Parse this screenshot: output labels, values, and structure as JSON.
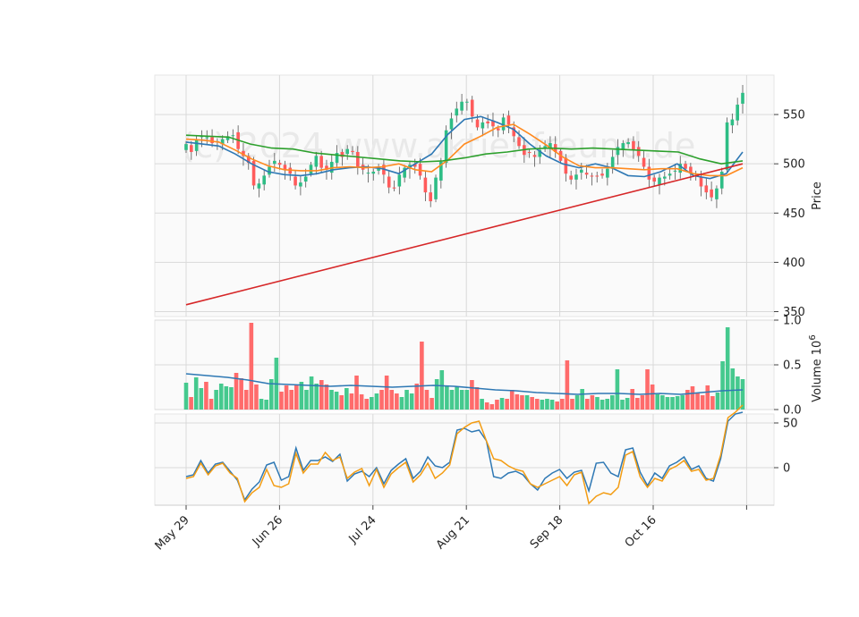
{
  "chart_data": {
    "type": "candlestick",
    "watermark": "(c) 2024 www.aktienfreund.de",
    "x_tick_labels": [
      "May 29",
      "Jun 26",
      "Jul 24",
      "Aug 21",
      "Sep 18",
      "Oct 16",
      ""
    ],
    "panels": [
      {
        "name": "price",
        "ylabel": "Price",
        "ylim": [
          345,
          590
        ],
        "yticks": [
          350,
          400,
          450,
          500,
          550
        ],
        "grid": true,
        "candles_close_path": [
          520,
          512,
          524,
          528,
          527,
          521,
          523,
          525,
          528,
          529,
          515,
          508,
          501,
          478,
          480,
          488,
          497,
          503,
          499,
          494,
          490,
          478,
          481,
          487,
          499,
          508,
          496,
          494,
          502,
          511,
          507,
          515,
          512,
          497,
          494,
          491,
          492,
          496,
          489,
          476,
          475,
          489,
          496,
          499,
          497,
          488,
          471,
          462,
          486,
          502,
          534,
          546,
          556,
          563,
          563,
          548,
          537,
          542,
          541,
          538,
          534,
          547,
          540,
          528,
          518,
          509,
          511,
          507,
          514,
          518,
          521,
          512,
          503,
          490,
          484,
          489,
          494,
          489,
          487,
          487,
          488,
          495,
          507,
          517,
          521,
          522,
          514,
          508,
          497,
          484,
          482,
          486,
          487,
          490,
          493,
          500,
          495,
          491,
          488,
          477,
          471,
          466,
          475,
          492,
          542,
          545,
          560,
          572
        ],
        "ma_colors": [
          "#2e78b4",
          "#ff8a1f",
          "#2ca02c",
          "#d62728"
        ],
        "moving_averages": [
          {
            "period_hint": "short",
            "values": [
              522,
              520,
              518,
              510,
              500,
              492,
              489,
              488,
              490,
              494,
              496,
              497,
              495,
              490,
              500,
              510,
              530,
              545,
              548,
              542,
              535,
              520,
              508,
              500,
              496,
              500,
              496,
              488,
              487,
              492,
              500,
              488,
              485,
              490,
              512
            ]
          },
          {
            "period_hint": "medium",
            "values": [
              525,
              524,
              522,
              514,
              505,
              498,
              494,
              493,
              493,
              496,
              497,
              496,
              497,
              500,
              494,
              492,
              504,
              520,
              528,
              537,
              540,
              530,
              519,
              507,
              498,
              496,
              496,
              495,
              494,
              495,
              495,
              490,
              488,
              488,
              496
            ]
          },
          {
            "period_hint": "long",
            "values": [
              529,
              528,
              527,
              520,
              516,
              515,
              511,
              509,
              507,
              505,
              503,
              502,
              503,
              506,
              510,
              512,
              515,
              516,
              515,
              516,
              515,
              514,
              513,
              512,
              505,
              500,
              503
            ]
          },
          {
            "period_hint": "200",
            "values": [
              357,
              500
            ]
          }
        ]
      },
      {
        "name": "volume",
        "ylabel": "Volume  10^6",
        "ylim": [
          0,
          1.0
        ],
        "yticks": [
          0.0,
          0.5,
          1.0
        ],
        "grid": true,
        "values": [
          0.3,
          0.14,
          0.36,
          0.24,
          0.31,
          0.12,
          0.22,
          0.29,
          0.26,
          0.25,
          0.41,
          0.35,
          0.22,
          0.97,
          0.28,
          0.12,
          0.11,
          0.34,
          0.58,
          0.2,
          0.27,
          0.22,
          0.27,
          0.31,
          0.22,
          0.37,
          0.29,
          0.33,
          0.28,
          0.22,
          0.2,
          0.16,
          0.24,
          0.18,
          0.38,
          0.17,
          0.12,
          0.14,
          0.18,
          0.22,
          0.38,
          0.22,
          0.18,
          0.14,
          0.22,
          0.18,
          0.29,
          0.76,
          0.22,
          0.13,
          0.34,
          0.44,
          0.26,
          0.22,
          0.25,
          0.22,
          0.22,
          0.33,
          0.25,
          0.12,
          0.08,
          0.06,
          0.11,
          0.13,
          0.12,
          0.22,
          0.17,
          0.16,
          0.16,
          0.14,
          0.12,
          0.11,
          0.12,
          0.11,
          0.09,
          0.12,
          0.55,
          0.12,
          0.16,
          0.23,
          0.12,
          0.16,
          0.14,
          0.11,
          0.12,
          0.16,
          0.45,
          0.11,
          0.13,
          0.23,
          0.13,
          0.16,
          0.45,
          0.28,
          0.17,
          0.16,
          0.14,
          0.14,
          0.15,
          0.16,
          0.22,
          0.26,
          0.18,
          0.16,
          0.27,
          0.15,
          0.19,
          0.54,
          0.92,
          0.46,
          0.37,
          0.34
        ],
        "ma_values": [
          0.4,
          0.38,
          0.36,
          0.33,
          0.29,
          0.28,
          0.27,
          0.26,
          0.27,
          0.26,
          0.25,
          0.26,
          0.27,
          0.26,
          0.24,
          0.22,
          0.21,
          0.19,
          0.18,
          0.17,
          0.18,
          0.18,
          0.17,
          0.18,
          0.17,
          0.19,
          0.21,
          0.22
        ],
        "ma_color": "#2e78b4"
      },
      {
        "name": "oscillator",
        "ylim": [
          -42,
          60
        ],
        "yticks": [
          0,
          50
        ],
        "grid": true,
        "series": [
          {
            "color": "#2e78b4",
            "values": [
              -10,
              -8,
              8,
              -6,
              4,
              6,
              -4,
              -14,
              -36,
              -24,
              -16,
              3,
              6,
              -14,
              -10,
              22,
              -3,
              8,
              8,
              12,
              7,
              15,
              -15,
              -7,
              -4,
              -10,
              0,
              -18,
              -3,
              4,
              10,
              -12,
              -4,
              12,
              2,
              0,
              6,
              42,
              44,
              40,
              42,
              30,
              -10,
              -12,
              -6,
              -4,
              -8,
              -18,
              -25,
              -12,
              -6,
              -2,
              -12,
              -5,
              -3,
              -26,
              5,
              6,
              -6,
              -10,
              20,
              22,
              -5,
              -20,
              -6,
              -12,
              2,
              6,
              12,
              -2,
              2,
              -12,
              -15,
              10,
              52,
              60,
              62
            ]
          },
          {
            "color": "#f39c12",
            "values": [
              -12,
              -10,
              5,
              -8,
              2,
              5,
              -6,
              -12,
              -38,
              -28,
              -22,
              -2,
              -20,
              -22,
              -18,
              16,
              -6,
              4,
              4,
              17,
              8,
              12,
              -12,
              -5,
              -1,
              -20,
              -2,
              -22,
              -7,
              0,
              6,
              -16,
              -8,
              5,
              -12,
              -6,
              3,
              38,
              45,
              50,
              52,
              30,
              10,
              8,
              2,
              -2,
              -4,
              -18,
              -22,
              -18,
              -14,
              -10,
              -20,
              -8,
              -5,
              -40,
              -32,
              -28,
              -30,
              -22,
              14,
              18,
              -10,
              -22,
              -12,
              -15,
              -2,
              2,
              8,
              -4,
              -2,
              -14,
              -12,
              14,
              56,
              62,
              70
            ]
          }
        ]
      }
    ]
  }
}
